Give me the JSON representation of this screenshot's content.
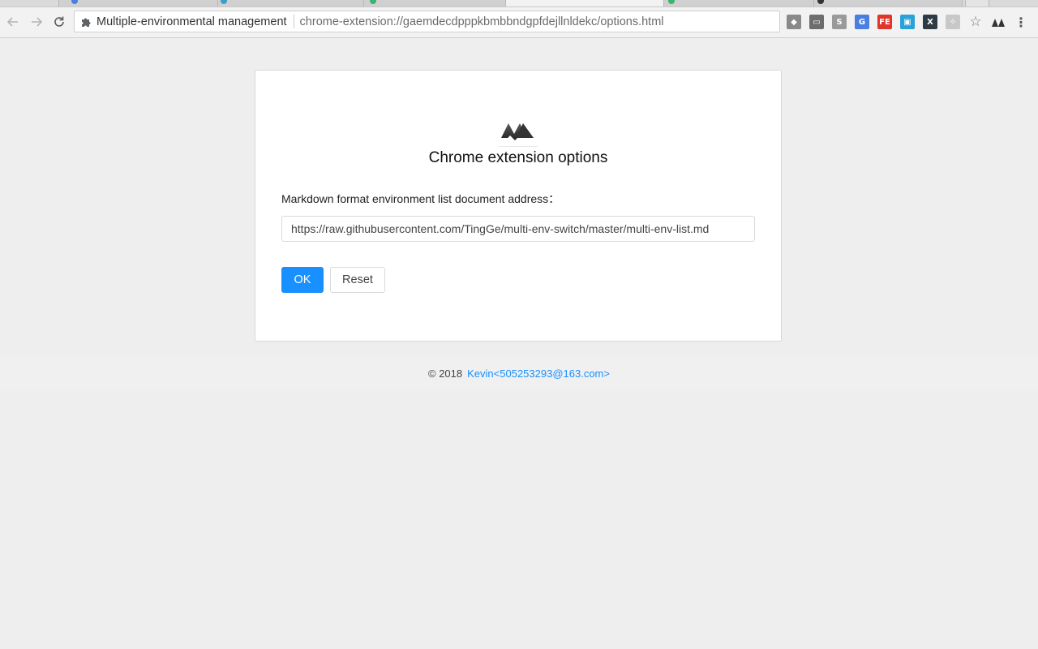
{
  "browser": {
    "page_title": "Multiple-environmental management",
    "url": "chrome-extension://gaemdecdpppkbmbbndgpfdejllnldekc/options.html",
    "toolbar_icons": [
      {
        "name": "layers-extension-icon",
        "glyph": "◆",
        "color": "#8a8a8a"
      },
      {
        "name": "window-extension-icon",
        "glyph": "▭",
        "color": "#6d6d6d"
      },
      {
        "name": "s-extension-icon",
        "glyph": "S",
        "color": "#9a9a9a"
      },
      {
        "name": "translate-extension-icon",
        "glyph": "G",
        "color": "#4a7fe0"
      },
      {
        "name": "fe-extension-icon",
        "glyph": "FE",
        "color": "#e0352b"
      },
      {
        "name": "reader-extension-icon",
        "glyph": "▣",
        "color": "#2aa1d8"
      },
      {
        "name": "x-extension-icon",
        "glyph": "X",
        "color": "#2f3b44"
      },
      {
        "name": "puzzle-extension-icon",
        "glyph": "✧",
        "color": "#c8c8c8"
      }
    ]
  },
  "page": {
    "heading": "Chrome extension options",
    "field_label": "Markdown format environment list document address：",
    "field_value": "https://raw.githubusercontent.com/TingGe/multi-env-switch/master/multi-env-list.md",
    "ok_label": "OK",
    "reset_label": "Reset"
  },
  "footer": {
    "copyright": "© 2018",
    "author_link": "Kevin<505253293@163.com>"
  },
  "colors": {
    "primary": "#1890ff",
    "background": "#eeeeee"
  }
}
